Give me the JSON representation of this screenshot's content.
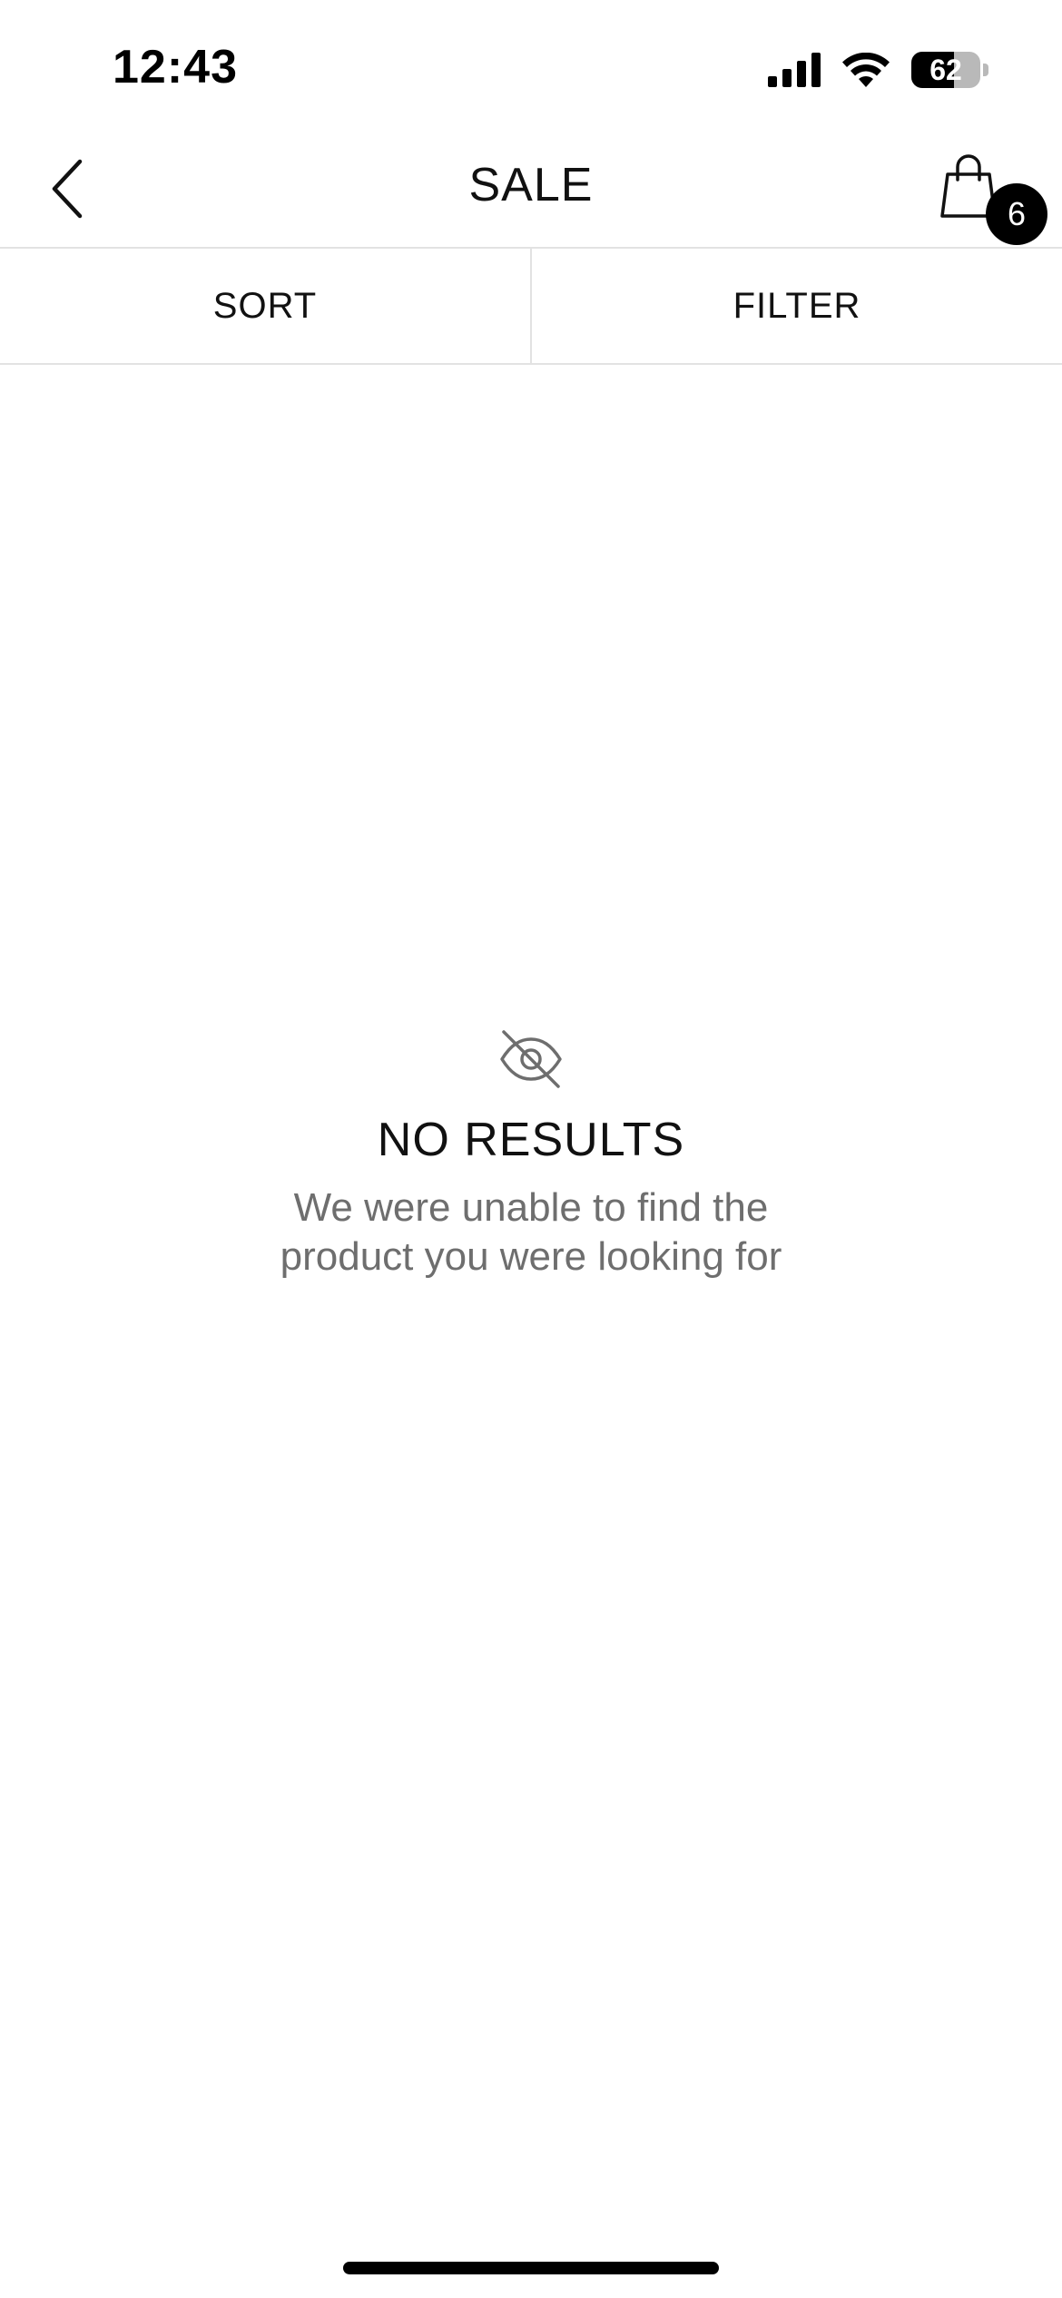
{
  "status_bar": {
    "time": "12:43",
    "battery_level": "62",
    "battery_fraction": 0.62,
    "icons": [
      "signal-icon",
      "wifi-icon",
      "battery-icon"
    ]
  },
  "header": {
    "back_icon": "chevron-left-icon",
    "title": "SALE",
    "cart_icon": "shopping-bag-icon",
    "cart_count": "6"
  },
  "toolbar": {
    "sort_label": "SORT",
    "filter_label": "FILTER"
  },
  "empty_state": {
    "icon": "eye-off-icon",
    "title": "NO RESULTS",
    "message_line1": "We were unable to find the",
    "message_line2": "product you were looking for"
  },
  "colors": {
    "background": "#ffffff",
    "text": "#111111",
    "muted_text": "#6e6e6e",
    "divider": "#e2e2e2",
    "badge": "#000000"
  }
}
